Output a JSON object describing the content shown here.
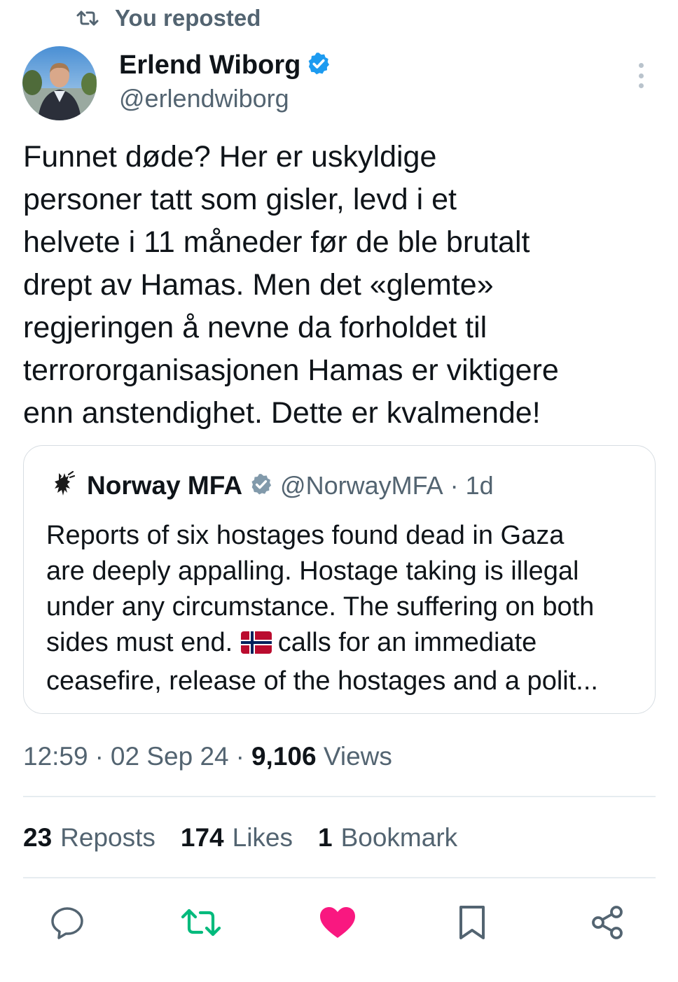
{
  "repost_banner": {
    "label": "You reposted"
  },
  "author": {
    "name": "Erlend Wiborg",
    "handle": "@erlendwiborg",
    "verified": true
  },
  "tweet": {
    "text": "Funnet døde? Her er uskyldige\npersoner tatt som gisler, levd i et\nhelvete i 11 måneder før de ble brutalt\ndrept av Hamas. Men det «glemte»\nregjeringen å nevne da forholdet til\nterrororganisasjonen Hamas er viktigere\nenn anstendighet. Dette er kvalmende!"
  },
  "quote": {
    "name": "Norway MFA",
    "handle": "@NorwayMFA",
    "separator": "·",
    "time": "1d",
    "text_before_flag": "Reports of six hostages found dead in Gaza\nare deeply appalling. Hostage taking is illegal\nunder any circumstance. The suffering on both\nsides must end. ",
    "text_after_flag": "calls for an immediate\nceasefire, release of the hostages and a polit..."
  },
  "meta": {
    "time": "12:59",
    "sep1": "·",
    "date": "02 Sep 24",
    "sep2": "·",
    "views_count": "9,106",
    "views_label": "Views"
  },
  "stats": [
    {
      "count": "23",
      "label": "Reposts"
    },
    {
      "count": "174",
      "label": "Likes"
    },
    {
      "count": "1",
      "label": "Bookmark"
    }
  ],
  "colors": {
    "primary_text": "#0f1419",
    "secondary_text": "#536471",
    "verified": "#1d9bf0",
    "repost_active": "#00ba7c",
    "like_active": "#f91880",
    "border": "#d7dde2"
  },
  "actions": [
    "reply-icon",
    "repost-icon",
    "like-icon",
    "bookmark-icon",
    "share-icon"
  ]
}
